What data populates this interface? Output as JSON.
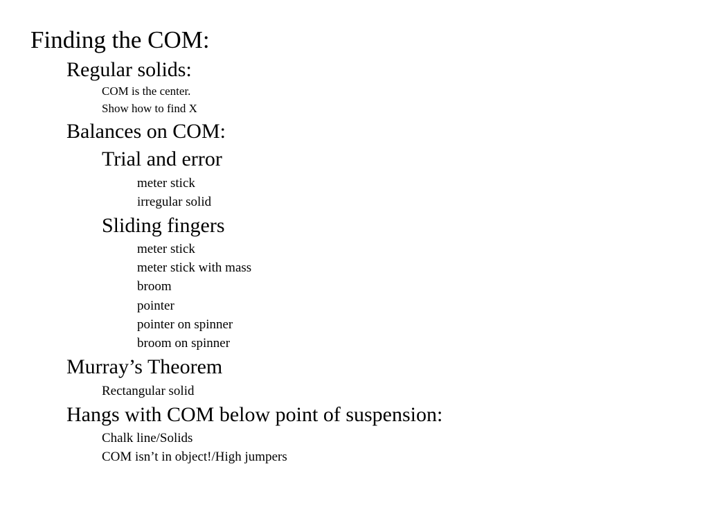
{
  "slide": {
    "title": "Finding the COM:",
    "regular": {
      "heading": "Regular solids:",
      "items": [
        "COM is the center.",
        "Show how to find X"
      ]
    },
    "balances": {
      "heading": "Balances on COM:",
      "trial": {
        "heading": "Trial and error",
        "items": [
          "meter stick",
          "irregular solid"
        ]
      },
      "sliding": {
        "heading": "Sliding fingers",
        "items": [
          "meter stick",
          "meter stick with mass",
          "broom",
          "pointer",
          "pointer on spinner",
          "broom on spinner"
        ]
      }
    },
    "murray": {
      "heading": "Murray’s Theorem",
      "items": [
        "Rectangular solid"
      ]
    },
    "hangs": {
      "heading": "Hangs with COM below point of suspension:",
      "items": [
        "Chalk line/Solids",
        "COM isn’t in object!/High jumpers"
      ]
    }
  }
}
